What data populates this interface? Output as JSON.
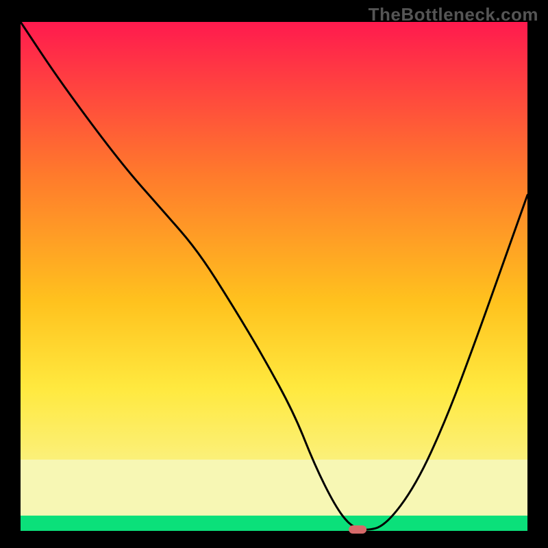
{
  "watermark": "TheBottleneck.com",
  "colors": {
    "top": "#ff1a4e",
    "mid1": "#ff7a2c",
    "mid2": "#ffc21e",
    "mid3": "#ffe93f",
    "pale": "#f7f7b4",
    "green": "#0be07a",
    "black": "#000000",
    "curve": "#000000",
    "marker": "#d66a6a"
  },
  "chart_data": {
    "type": "line",
    "title": "",
    "xlabel": "",
    "ylabel": "",
    "xlim": [
      0,
      100
    ],
    "ylim": [
      0,
      100
    ],
    "x": [
      0,
      8,
      20,
      28,
      35,
      42,
      48,
      54,
      58,
      62,
      65,
      68,
      72,
      78,
      84,
      90,
      95,
      100
    ],
    "y": [
      100,
      88,
      72,
      63,
      55,
      44,
      34,
      23,
      13,
      5,
      1,
      0,
      1,
      9,
      22,
      38,
      52,
      66
    ],
    "flat_segment_x": [
      62,
      70
    ],
    "marker": {
      "x": 66.5,
      "y": 0
    },
    "green_band_y": [
      0,
      3
    ],
    "pale_band_y": [
      3,
      14
    ]
  }
}
